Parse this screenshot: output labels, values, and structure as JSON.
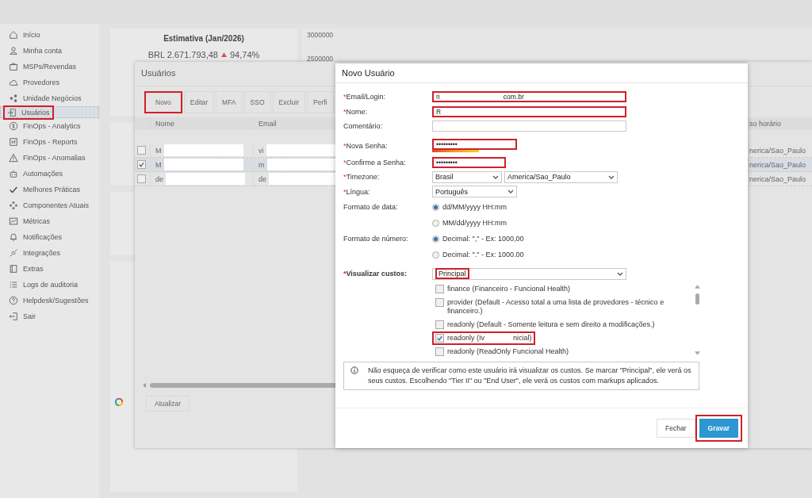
{
  "sidebar": {
    "items": [
      {
        "label": "Início",
        "selected": false,
        "highlighted": false
      },
      {
        "label": "Minha conta",
        "selected": false,
        "highlighted": false
      },
      {
        "label": "MSPs/Revendas",
        "selected": false,
        "highlighted": false
      },
      {
        "label": "Provedores",
        "selected": false,
        "highlighted": false
      },
      {
        "label": "Unidade Negócios",
        "selected": false,
        "highlighted": false
      },
      {
        "label": "Usuários",
        "selected": true,
        "highlighted": true
      },
      {
        "label": "FinOps - Analytics",
        "selected": false,
        "highlighted": false
      },
      {
        "label": "FinOps - Reports",
        "selected": false,
        "highlighted": false
      },
      {
        "label": "FinOps - Anomalias",
        "selected": false,
        "highlighted": false
      },
      {
        "label": "Automações",
        "selected": false,
        "highlighted": false
      },
      {
        "label": "Melhores Práticas",
        "selected": false,
        "highlighted": false
      },
      {
        "label": "Componentes Atuais",
        "selected": false,
        "highlighted": false
      },
      {
        "label": "Métricas",
        "selected": false,
        "highlighted": false
      },
      {
        "label": "Notificações",
        "selected": false,
        "highlighted": false
      },
      {
        "label": "Integrações",
        "selected": false,
        "highlighted": false
      },
      {
        "label": "Extras",
        "selected": false,
        "highlighted": false
      },
      {
        "label": "Logs de auditoria",
        "selected": false,
        "highlighted": false
      },
      {
        "label": "Helpdesk/Sugestões",
        "selected": false,
        "highlighted": false
      },
      {
        "label": "Sair",
        "selected": false,
        "highlighted": false
      }
    ]
  },
  "dashboard": {
    "estimate_card": {
      "title": "Estimativa (Jan/2026)",
      "value": "BRL 2.671.793,48",
      "rising": true,
      "change": "94,74%"
    },
    "chart_axis_labels": [
      "3000000",
      "2500000"
    ]
  },
  "users_window": {
    "title": "Usuários",
    "toolbar": [
      {
        "label": "Novo",
        "highlighted": true
      },
      {
        "label": "Editar",
        "highlighted": false
      },
      {
        "label": "MFA",
        "highlighted": false
      },
      {
        "label": "SSO",
        "highlighted": false
      },
      {
        "label": "Excluir",
        "highlighted": false
      },
      {
        "label": "Perfi",
        "highlighted": false
      }
    ],
    "table": {
      "columns": [
        "Nome",
        "Email"
      ],
      "column_right": "so horário",
      "rows": [
        {
          "checked": false,
          "selected": false,
          "name": "M",
          "email": "vi",
          "timezone": "nerica/Sao_Paulo"
        },
        {
          "checked": true,
          "selected": true,
          "name": "M",
          "email": "m",
          "timezone": "nerica/Sao_Paulo"
        },
        {
          "checked": false,
          "selected": false,
          "name": "de",
          "email": "de",
          "timezone": "nerica/Sao_Paulo"
        }
      ]
    },
    "refresh_button": "Atualizar"
  },
  "dialog": {
    "title": "Novo Usuário",
    "email": {
      "required_mark": "*",
      "label": "Email/Login:",
      "value_start": "ri",
      "value_end": "com.br",
      "highlighted": true
    },
    "name": {
      "required_mark": "*",
      "label": "Nome:",
      "value_start": "R",
      "highlighted": true
    },
    "comment": {
      "label": "Comentário:"
    },
    "new_password": {
      "required_mark": "*",
      "label": "Nova Senha:",
      "value": "•••••••••",
      "level": 0.55,
      "highlighted": true
    },
    "confirm_password": {
      "required_mark": "*",
      "label": "Confirme a Senha:",
      "value": "•••••••••",
      "highlighted": true
    },
    "timezone": {
      "required_mark": "*",
      "label": "Timezone:",
      "region": "Brasil",
      "zone": "America/Sao_Paulo"
    },
    "language": {
      "required_mark": "*",
      "label": "Língua:",
      "value": "Português"
    },
    "date_format": {
      "label": "Formato de data:",
      "options": [
        {
          "label": "dd/MM/yyyy HH:mm",
          "selected": true
        },
        {
          "label": "MM/dd/yyyy HH:mm",
          "selected": false
        }
      ]
    },
    "number_format": {
      "label": "Formato de número:",
      "options": [
        {
          "label": "Decimal: \",\" - Ex: 1000,00",
          "selected": true
        },
        {
          "label": "Decimal: \".\" - Ex: 1000.00",
          "selected": false
        }
      ]
    },
    "view_costs": {
      "required_mark": "*",
      "label": "Visualizar custos:",
      "value": "Principal",
      "highlighted": true
    },
    "profiles": [
      {
        "label_start": "finance (Financeiro - Funcional Health)",
        "checked": false,
        "highlighted": false
      },
      {
        "label_start": "provider (Default - Acesso total a uma lista de provedores - técnico e financeiro.)",
        "checked": false,
        "highlighted": false
      },
      {
        "label_start": "readonly (Default - Somente leitura e sem direito a modificações.)",
        "checked": false,
        "highlighted": false
      },
      {
        "label_start": "readonly (Iv",
        "label_end": "nicial)",
        "checked": true,
        "highlighted": true
      },
      {
        "label_start": "readonly (ReadOnly Funcional Health)",
        "checked": false,
        "highlighted": false
      }
    ],
    "note": "Não esqueça de verificar como este usuário irá visualizar os custos. Se marcar \"Principal\", ele verá os seus custos. Escolhendo \"Tier II\" ou \"End User\", ele verá os custos com markups aplicados.",
    "buttons": [
      {
        "label": "Fechar",
        "kind": "secondary",
        "highlighted": false
      },
      {
        "label": "Gravar",
        "kind": "primary",
        "highlighted": true
      }
    ]
  }
}
